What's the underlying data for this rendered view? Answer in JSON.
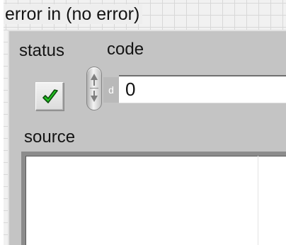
{
  "cluster": {
    "title": "error in (no error)"
  },
  "status": {
    "label": "status",
    "value": true,
    "check_color": "#1fbf1f"
  },
  "code": {
    "label": "code",
    "radix": "d",
    "value": "0"
  },
  "source": {
    "label": "source",
    "value": ""
  }
}
